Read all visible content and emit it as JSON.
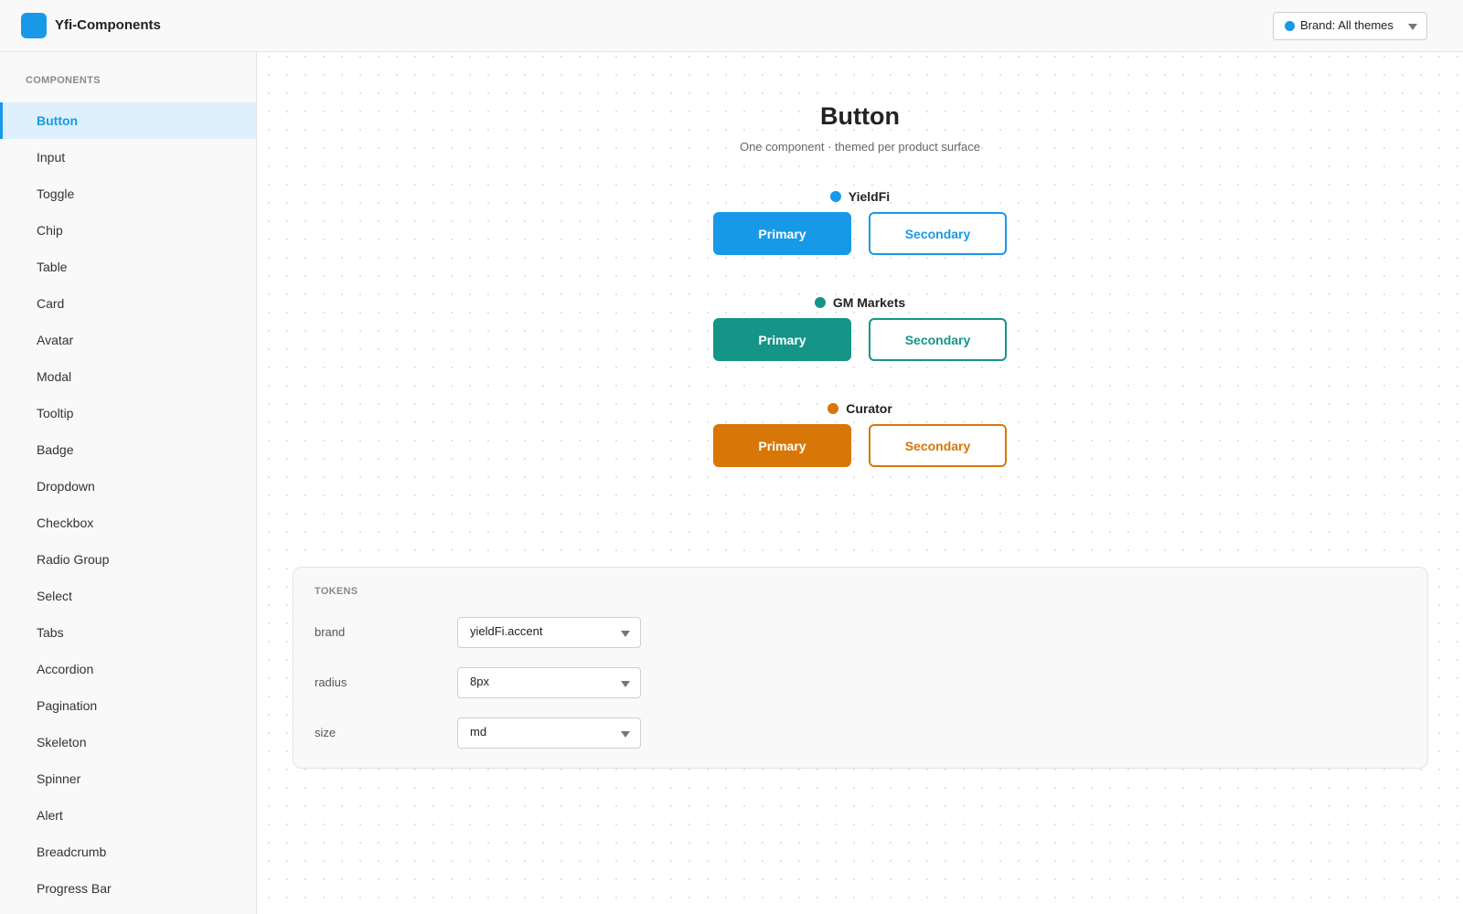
{
  "app": {
    "title": "Yfi-Components",
    "logo_color": "#1899e8"
  },
  "header": {
    "brand_select": {
      "label": "Brand: All themes",
      "dot_color": "#1899e8"
    }
  },
  "sidebar": {
    "heading": "COMPONENTS",
    "active_item": "Button",
    "items": [
      {
        "label": "Button"
      },
      {
        "label": "Input"
      },
      {
        "label": "Toggle"
      },
      {
        "label": "Chip"
      },
      {
        "label": "Table"
      },
      {
        "label": "Card"
      },
      {
        "label": "Avatar"
      },
      {
        "label": "Modal"
      },
      {
        "label": "Tooltip"
      },
      {
        "label": "Badge"
      },
      {
        "label": "Dropdown"
      },
      {
        "label": "Checkbox"
      },
      {
        "label": "Radio Group"
      },
      {
        "label": "Select"
      },
      {
        "label": "Tabs"
      },
      {
        "label": "Accordion"
      },
      {
        "label": "Pagination"
      },
      {
        "label": "Skeleton"
      },
      {
        "label": "Spinner"
      },
      {
        "label": "Alert"
      },
      {
        "label": "Breadcrumb"
      },
      {
        "label": "Progress Bar"
      }
    ]
  },
  "main": {
    "title": "Button",
    "subtitle": "One component · themed per product surface",
    "brands": [
      {
        "name": "YieldFi",
        "color": "#1899e8",
        "primary_label": "Primary",
        "secondary_label": "Secondary"
      },
      {
        "name": "GM Markets",
        "color": "#149587",
        "primary_label": "Primary",
        "secondary_label": "Secondary"
      },
      {
        "name": "Curator",
        "color": "#d87608",
        "primary_label": "Primary",
        "secondary_label": "Secondary"
      }
    ]
  },
  "tokens": {
    "heading": "TOKENS",
    "rows": [
      {
        "name": "brand",
        "value": "yieldFi.accent"
      },
      {
        "name": "radius",
        "value": "8px"
      },
      {
        "name": "size",
        "value": "md"
      }
    ]
  }
}
